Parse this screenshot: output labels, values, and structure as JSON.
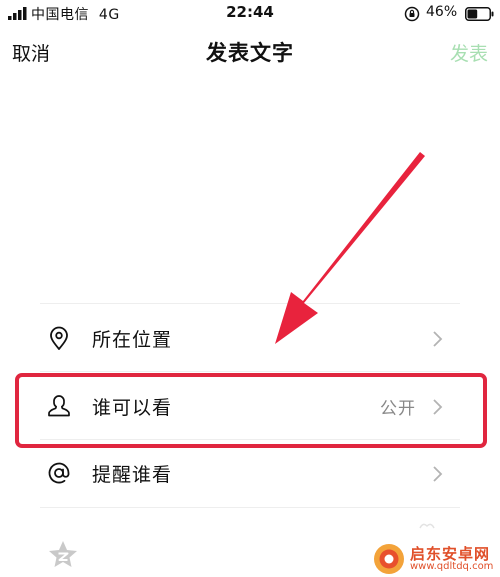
{
  "status_bar": {
    "carrier": "中国电信",
    "network": "4G",
    "time": "22:44",
    "battery_percent": "46%",
    "battery_level": 0.46
  },
  "nav": {
    "cancel": "取消",
    "title": "发表文字",
    "post": "发表",
    "post_color": "#a8dfb2"
  },
  "rows": [
    {
      "label": "所在位置",
      "value": "",
      "icon": "location-pin-icon"
    },
    {
      "label": "谁可以看",
      "value": "公开",
      "icon": "person-icon"
    },
    {
      "label": "提醒谁看",
      "value": "",
      "icon": "at-sign-icon"
    }
  ],
  "annotation": {
    "color": "#e0263f",
    "highlight_target": "谁可以看"
  },
  "watermark": {
    "name": "启东安卓网",
    "url": "www.qdltdq.com"
  }
}
